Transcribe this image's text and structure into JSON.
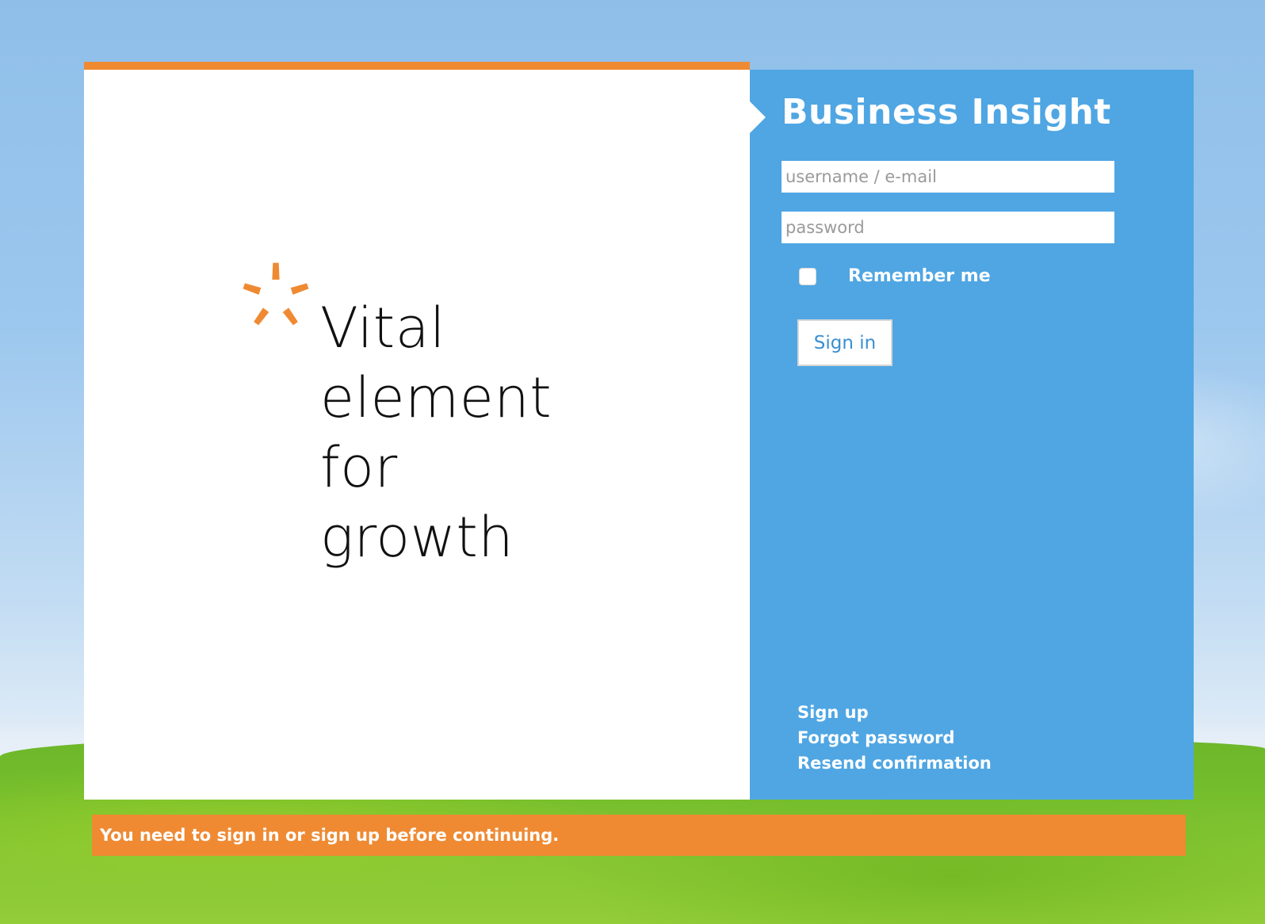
{
  "brand": {
    "tagline_lines": [
      "Vital",
      "element",
      "for",
      "growth"
    ],
    "accent_color": "#ef8a33",
    "logo_icon": "star-logo-icon"
  },
  "login": {
    "title": "Business Insight",
    "panel_color": "#4fa6e3",
    "username": {
      "placeholder": "username / e-mail",
      "value": ""
    },
    "password": {
      "placeholder": "password",
      "value": ""
    },
    "remember_me": {
      "label": "Remember me",
      "checked": false
    },
    "sign_in_label": "Sign in",
    "links": {
      "sign_up": "Sign up",
      "forgot_password": "Forgot password",
      "resend_confirmation": "Resend confirmation"
    }
  },
  "flash": {
    "message": "You need to sign in or sign up before continuing.",
    "color": "#ef8a33"
  }
}
